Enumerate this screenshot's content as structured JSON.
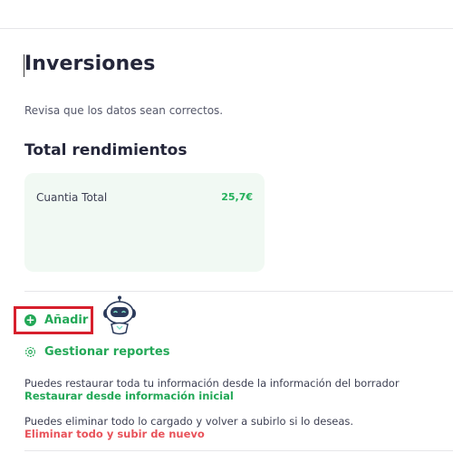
{
  "page": {
    "title": "Inversiones",
    "subtitle": "Revisa que los datos sean correctos."
  },
  "summary": {
    "section_title": "Total rendimientos",
    "card": {
      "label": "Cuantia Total",
      "value": "25,7€"
    }
  },
  "actions": {
    "add_label": "Añadir",
    "reports_label": "Gestionar reportes"
  },
  "restore": {
    "text": "Puedes restaurar toda tu información desde la información del borrador",
    "link": "Restaurar desde información inicial"
  },
  "delete": {
    "text": "Puedes eliminar todo lo cargado y volver a subirlo si lo deseas.",
    "link": "Eliminar todo y subir de nuevo"
  },
  "icons": {
    "add": "plus-circle-icon",
    "reports": "gear-icon",
    "assistant": "robot-icon"
  },
  "colors": {
    "accent_green": "#23a857",
    "danger_red": "#e8525a",
    "highlight_border": "#d71f2c",
    "card_bg": "#f1f9f3"
  }
}
